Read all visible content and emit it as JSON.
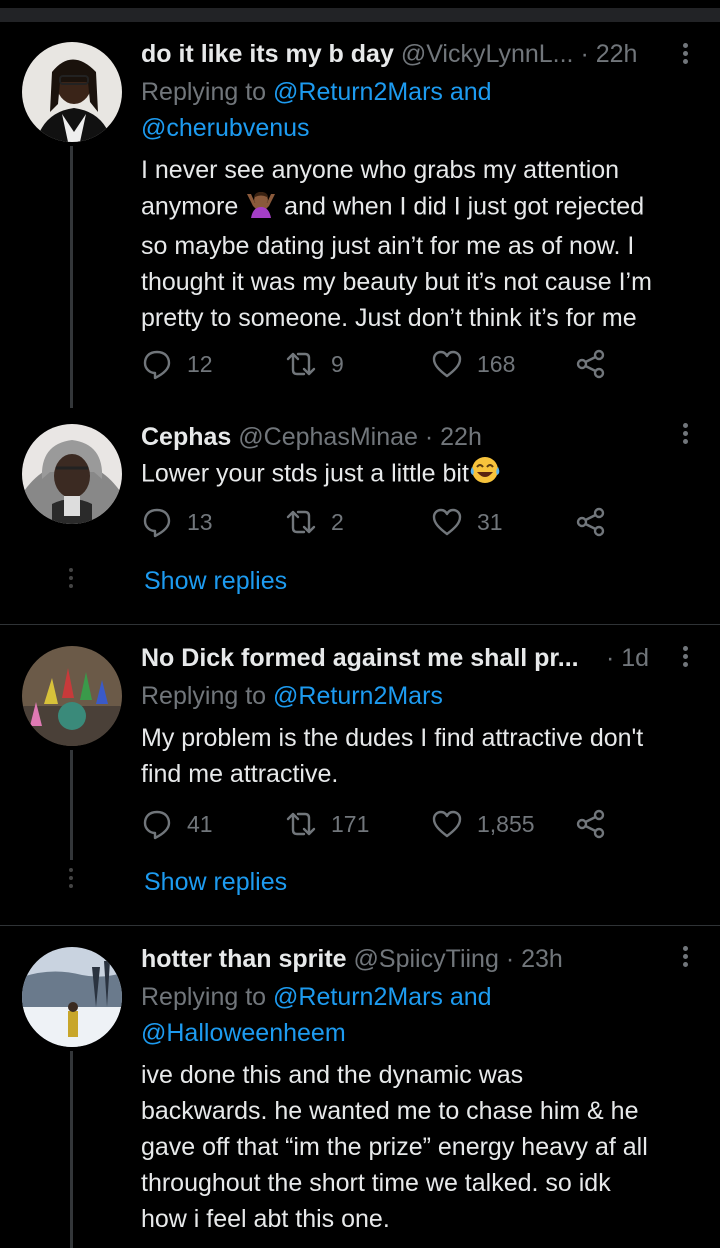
{
  "tweets": [
    {
      "name": "do it like its my b day",
      "handle": "@VickyLynnL...",
      "time": "· 22h",
      "reply_prefix": "Replying to ",
      "reply_line1": "@Return2Mars and",
      "reply_line2": "@cherubvenus",
      "text_l1a": "I never see anyone who grabs my attention",
      "text_l2a": "anymore",
      "text_l2b": " and when I did I just got rejected",
      "text_l3": "so maybe dating just ain’t for me as of now. I",
      "text_l4": "thought it was my beauty but it’s not cause I’m",
      "text_l5": "pretty to someone. Just don’t think it’s for me",
      "replies": "12",
      "retweets": "9",
      "likes": "168"
    },
    {
      "name": "Cephas",
      "handle": "@CephasMinae",
      "time": "· 22h",
      "text": "Lower your stds just a little bit",
      "replies": "13",
      "retweets": "2",
      "likes": "31",
      "show_replies": "Show replies"
    },
    {
      "name": "No Dick formed against me shall pr...",
      "time": "· 1d",
      "reply_prefix": "Replying to ",
      "reply_line1": "@Return2Mars",
      "text_l1": "My problem is the dudes I find attractive don't",
      "text_l2": "find me attractive.",
      "replies": "41",
      "retweets": "171",
      "likes": "1,855",
      "show_replies": "Show replies"
    },
    {
      "name": "hotter than sprite",
      "handle": "@SpiicyTiing",
      "time": "· 23h",
      "reply_prefix": "Replying to ",
      "reply_line1": "@Return2Mars and",
      "reply_line2": "@Halloweenheem",
      "text_l1": "ive done this and the dynamic was",
      "text_l2": "backwards. he wanted me to chase him & he",
      "text_l3": "gave off that “im the prize” energy heavy af all",
      "text_l4": "throughout the short time we talked. so idk",
      "text_l5": "how i feel abt this one."
    }
  ],
  "icons": {
    "reply": "speech-bubble",
    "retweet": "retweet-arrows",
    "like": "heart",
    "share": "share-nodes",
    "more": "vertical-ellipsis"
  }
}
